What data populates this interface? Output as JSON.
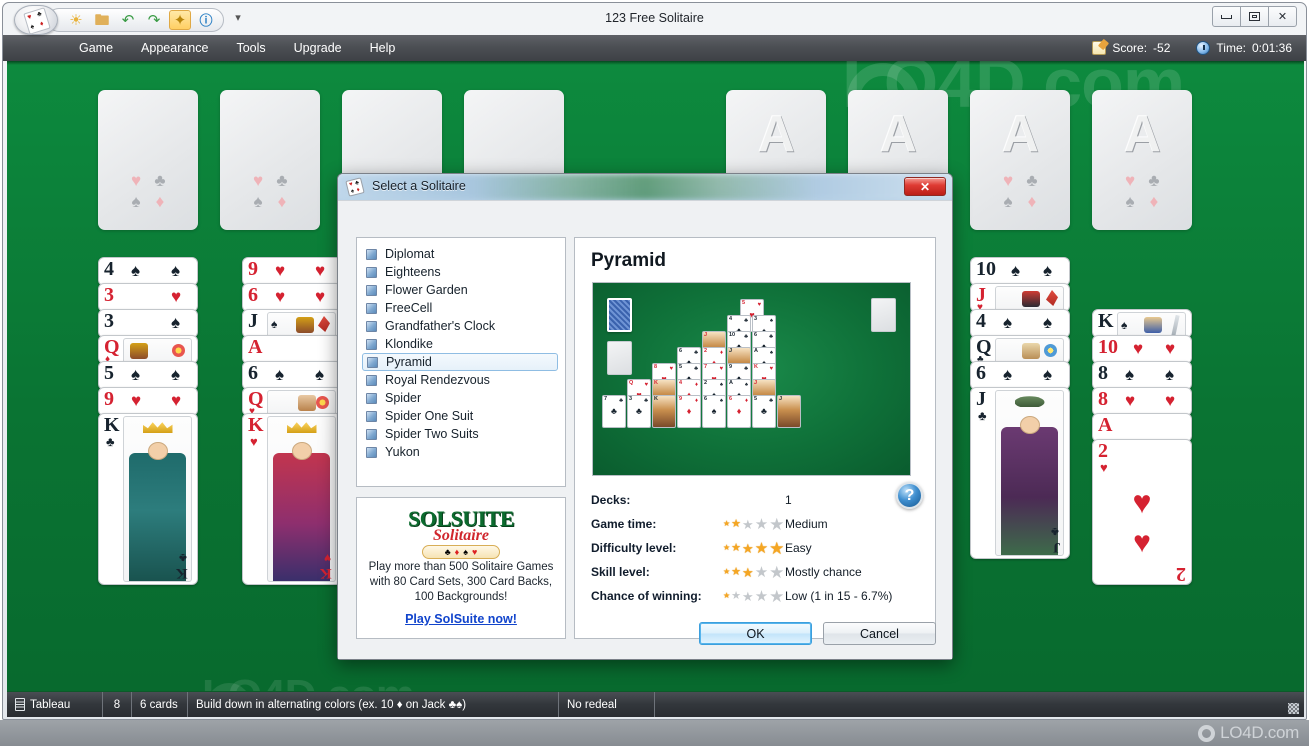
{
  "window": {
    "title": "123 Free Solitaire",
    "minimize_label": "Minimize",
    "restore_label": "Restore",
    "close_label": "Close"
  },
  "toolbar": {
    "buttons": [
      {
        "icon": "new-game-icon",
        "glyph": "☀",
        "active": false
      },
      {
        "icon": "open-folder-icon",
        "glyph": "📁",
        "active": false
      },
      {
        "icon": "undo-icon",
        "glyph": "↶",
        "active": false
      },
      {
        "icon": "redo-icon",
        "glyph": "↷",
        "active": false
      },
      {
        "icon": "magic-wand-icon",
        "glyph": "✦",
        "active": true
      },
      {
        "icon": "help-icon",
        "glyph": "?",
        "active": false
      }
    ],
    "overflow_glyph": "▾"
  },
  "menu": {
    "items": [
      "Game",
      "Appearance",
      "Tools",
      "Upgrade",
      "Help"
    ]
  },
  "status_header": {
    "score_label": "Score:",
    "score_value": "-52",
    "time_label": "Time:",
    "time_value": "0:01:36"
  },
  "watermark": {
    "brand": "LO4D.com"
  },
  "table": {
    "foundations_left": [
      {
        "name": "foundation-1",
        "mark": ""
      },
      {
        "name": "foundation-2",
        "mark": ""
      },
      {
        "name": "foundation-3",
        "mark": ""
      },
      {
        "name": "foundation-4",
        "mark": ""
      }
    ],
    "foundations_right": [
      {
        "name": "foundation-5",
        "mark": "A"
      },
      {
        "name": "foundation-6",
        "mark": "A"
      },
      {
        "name": "foundation-7",
        "mark": "A"
      },
      {
        "name": "foundation-8",
        "mark": "A"
      }
    ],
    "suit_glyphs": {
      "heart": "♥",
      "club": "♣",
      "spade": "♠",
      "diamond": "♦"
    },
    "columns": [
      {
        "name": "tableau-column-1",
        "cards": [
          "4♠",
          "3♥",
          "3♠",
          "Q♦",
          "5♠",
          "9♥",
          "K♣"
        ]
      },
      {
        "name": "tableau-column-2",
        "cards": [
          "9♥",
          "6♥",
          "J♠",
          "A♥",
          "6♠",
          "Q♥",
          "K♥"
        ]
      },
      {
        "name": "tableau-column-7",
        "cards": [
          "10♠",
          "J♥",
          "4♠",
          "Q♣",
          "6♠",
          "J♣"
        ]
      },
      {
        "name": "tableau-column-8",
        "cards": [
          "K♠",
          "10♥",
          "8♠",
          "8♥",
          "A♥",
          "2♥"
        ]
      }
    ]
  },
  "statusbar": {
    "pile_type": "Tableau",
    "pile_count": "8",
    "cards_text": "6 cards",
    "rule_text": "Build down in alternating colors (ex. 10 ♦ on Jack ♣♠)",
    "redeal_text": "No redeal"
  },
  "dialog": {
    "title": "Select a Solitaire",
    "close_glyph": "✕",
    "games": [
      "Diplomat",
      "Eighteens",
      "Flower Garden",
      "FreeCell",
      "Grandfather's Clock",
      "Klondike",
      "Pyramid",
      "Royal Rendezvous",
      "Spider",
      "Spider One Suit",
      "Spider Two Suits",
      "Yukon"
    ],
    "selected_game": "Pyramid",
    "promo": {
      "logo_main": "SOLSUITE",
      "logo_sub": "Solitaire",
      "pips": [
        "♣",
        "♦",
        "♠",
        "♥"
      ],
      "text": "Play more than 500 Solitaire Games with 80 Card Sets, 300 Card Backs, 100 Backgrounds!",
      "link": "Play SolSuite now!"
    },
    "detail": {
      "title": "Pyramid",
      "help_glyph": "?",
      "properties": [
        {
          "label": "Decks:",
          "stars": 0,
          "value": "1"
        },
        {
          "label": "Game time:",
          "stars": 2,
          "value": "Medium"
        },
        {
          "label": "Difficulty level:",
          "stars": 5,
          "value": "Easy"
        },
        {
          "label": "Skill level:",
          "stars": 3,
          "value": "Mostly chance"
        },
        {
          "label": "Chance of winning:",
          "stars": 1,
          "value": "Low (1 in 15  -  6.7%)"
        }
      ]
    },
    "buttons": {
      "ok": "OK",
      "cancel": "Cancel"
    }
  }
}
